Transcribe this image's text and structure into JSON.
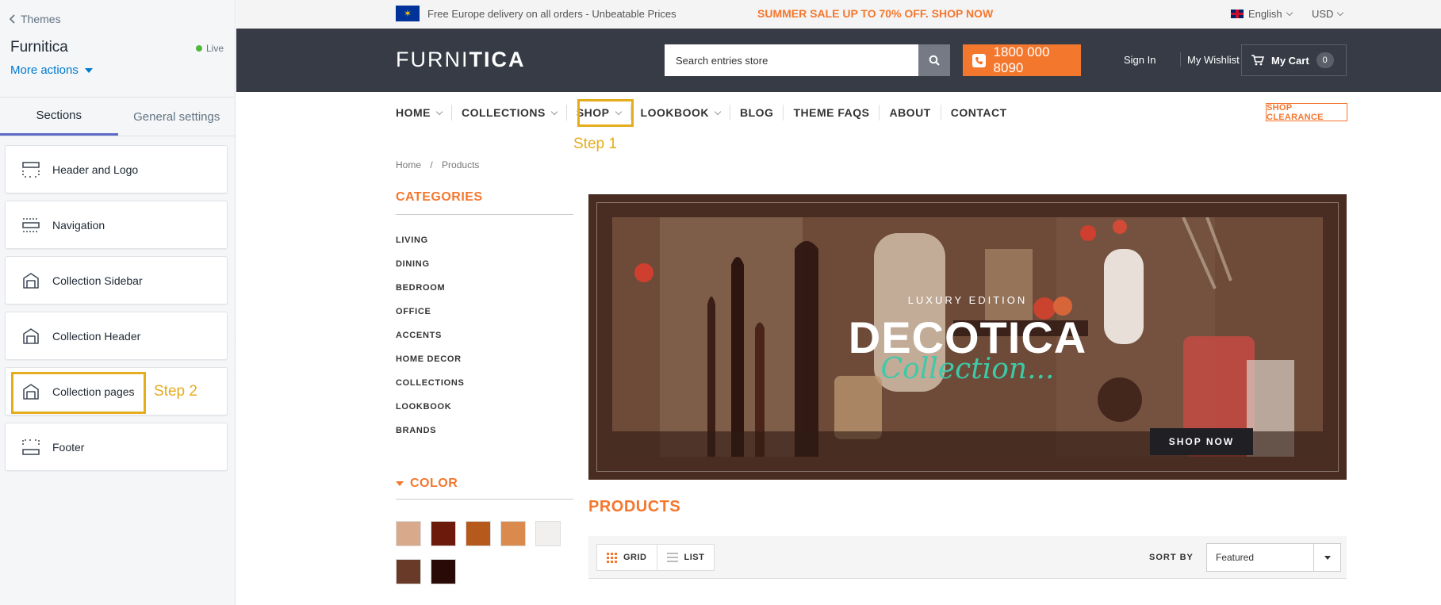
{
  "editor": {
    "back_link": "Themes",
    "theme_name": "Furnitica",
    "status": "Live",
    "more_actions": "More actions",
    "tabs": [
      {
        "label": "Sections",
        "active": true
      },
      {
        "label": "General settings",
        "active": false
      }
    ],
    "sections": [
      {
        "label": "Header and Logo",
        "icon": "header-layout-icon"
      },
      {
        "label": "Navigation",
        "icon": "navigation-layout-icon"
      },
      {
        "label": "Collection Sidebar",
        "icon": "collection-icon"
      },
      {
        "label": "Collection Header",
        "icon": "collection-icon"
      },
      {
        "label": "Collection pages",
        "icon": "collection-icon"
      },
      {
        "label": "Footer",
        "icon": "footer-layout-icon"
      }
    ]
  },
  "annotations": {
    "step1": "Step 1",
    "step2": "Step 2",
    "color": "#e5ac1d"
  },
  "store": {
    "promo": {
      "delivery": "Free Europe delivery on all orders - Unbeatable Prices",
      "sale": "SUMMER SALE UP TO 70% OFF. SHOP NOW",
      "language": "English",
      "currency": "USD"
    },
    "header": {
      "logo_light": "FURNI",
      "logo_bold": "TICA",
      "search_placeholder": "Search entries store",
      "phone": "1800 000 8090",
      "sign_in": "Sign In",
      "wishlist": "My Wishlist",
      "cart_label": "My Cart",
      "cart_count": "0"
    },
    "nav": [
      {
        "label": "HOME",
        "dropdown": true
      },
      {
        "label": "COLLECTIONS",
        "dropdown": true
      },
      {
        "label": "SHOP",
        "dropdown": true
      },
      {
        "label": "LOOKBOOK",
        "dropdown": true
      },
      {
        "label": "BLOG",
        "dropdown": false
      },
      {
        "label": "THEME FAQS",
        "dropdown": false
      },
      {
        "label": "ABOUT",
        "dropdown": false
      },
      {
        "label": "CONTACT",
        "dropdown": false
      }
    ],
    "shop_clearance": "SHOP CLEARANCE",
    "breadcrumb": [
      "Home",
      "/",
      "Products"
    ],
    "categories_title": "CATEGORIES",
    "categories": [
      "LIVING",
      "DINING",
      "BEDROOM",
      "OFFICE",
      "ACCENTS",
      "HOME DECOR",
      "COLLECTIONS",
      "LOOKBOOK",
      "BRANDS"
    ],
    "color_title": "COLOR",
    "swatches": [
      "#d8a98a",
      "#6b1a0c",
      "#b55a1c",
      "#d98a4c",
      "#f1f0ee",
      "#6a3a28",
      "#2a0a07"
    ],
    "banner": {
      "edition": "LUXURY EDITION",
      "title": "DECOTICA",
      "script": "Collection...",
      "button": "SHOP NOW"
    },
    "products_title": "PRODUCTS",
    "toolbar": {
      "grid": "GRID",
      "list": "LIST",
      "sort_label": "SORT BY",
      "sort_value": "Featured"
    },
    "accent": "#f4772e",
    "header_bg": "#363b45"
  }
}
